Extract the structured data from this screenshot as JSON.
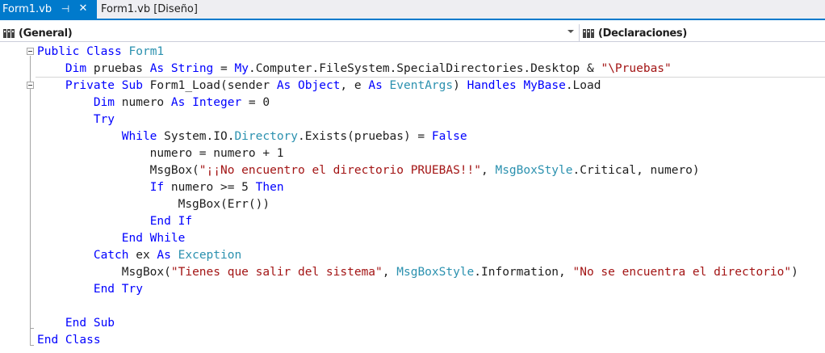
{
  "tabs": {
    "active": {
      "title": "Form1.vb",
      "pin_glyph": "⊣",
      "close_glyph": "✕"
    },
    "inactive": {
      "title": "Form1.vb [Diseño]"
    }
  },
  "navbar": {
    "left_label": "(General)",
    "right_label": "(Declaraciones)"
  },
  "colors": {
    "keyword": "#0000ff",
    "type": "#2b91af",
    "string": "#a31515",
    "plain": "#1e1e1e",
    "accent": "#007acc"
  },
  "code_lines": [
    [
      [
        "k",
        "Public Class "
      ],
      [
        "t",
        "Form1"
      ]
    ],
    [
      [
        "p",
        "    "
      ],
      [
        "k",
        "Dim"
      ],
      [
        "p",
        " pruebas "
      ],
      [
        "k",
        "As"
      ],
      [
        "p",
        " "
      ],
      [
        "k",
        "String"
      ],
      [
        "p",
        " = "
      ],
      [
        "k",
        "My"
      ],
      [
        "p",
        ".Computer.FileSystem.SpecialDirectories.Desktop & "
      ],
      [
        "s",
        "\"\\Pruebas\""
      ]
    ],
    [
      [
        "p",
        "    "
      ],
      [
        "k",
        "Private Sub"
      ],
      [
        "p",
        " Form1_Load(sender "
      ],
      [
        "k",
        "As"
      ],
      [
        "p",
        " "
      ],
      [
        "k",
        "Object"
      ],
      [
        "p",
        ", e "
      ],
      [
        "k",
        "As"
      ],
      [
        "p",
        " "
      ],
      [
        "t",
        "EventArgs"
      ],
      [
        "p",
        ") "
      ],
      [
        "k",
        "Handles"
      ],
      [
        "p",
        " "
      ],
      [
        "k",
        "MyBase"
      ],
      [
        "p",
        ".Load"
      ]
    ],
    [
      [
        "p",
        "        "
      ],
      [
        "k",
        "Dim"
      ],
      [
        "p",
        " numero "
      ],
      [
        "k",
        "As"
      ],
      [
        "p",
        " "
      ],
      [
        "k",
        "Integer"
      ],
      [
        "p",
        " = 0"
      ]
    ],
    [
      [
        "p",
        "        "
      ],
      [
        "k",
        "Try"
      ]
    ],
    [
      [
        "p",
        "            "
      ],
      [
        "k",
        "While"
      ],
      [
        "p",
        " System.IO."
      ],
      [
        "t",
        "Directory"
      ],
      [
        "p",
        ".Exists(pruebas) = "
      ],
      [
        "k",
        "False"
      ]
    ],
    [
      [
        "p",
        "                numero = numero + 1"
      ]
    ],
    [
      [
        "p",
        "                MsgBox("
      ],
      [
        "s",
        "\"¡¡No encuentro el directorio PRUEBAS!!\""
      ],
      [
        "p",
        ", "
      ],
      [
        "t",
        "MsgBoxStyle"
      ],
      [
        "p",
        ".Critical, numero)"
      ]
    ],
    [
      [
        "p",
        "                "
      ],
      [
        "k",
        "If"
      ],
      [
        "p",
        " numero >= 5 "
      ],
      [
        "k",
        "Then"
      ]
    ],
    [
      [
        "p",
        "                    MsgBox(Err())"
      ]
    ],
    [
      [
        "p",
        "                "
      ],
      [
        "k",
        "End If"
      ]
    ],
    [
      [
        "p",
        "            "
      ],
      [
        "k",
        "End While"
      ]
    ],
    [
      [
        "p",
        "        "
      ],
      [
        "k",
        "Catch"
      ],
      [
        "p",
        " ex "
      ],
      [
        "k",
        "As"
      ],
      [
        "p",
        " "
      ],
      [
        "t",
        "Exception"
      ]
    ],
    [
      [
        "p",
        "            MsgBox("
      ],
      [
        "s",
        "\"Tienes que salir del sistema\""
      ],
      [
        "p",
        ", "
      ],
      [
        "t",
        "MsgBoxStyle"
      ],
      [
        "p",
        ".Information, "
      ],
      [
        "s",
        "\"No se encuentra el directorio\""
      ],
      [
        "p",
        ")"
      ]
    ],
    [
      [
        "p",
        "        "
      ],
      [
        "k",
        "End Try"
      ]
    ],
    [
      [
        "p",
        ""
      ]
    ],
    [
      [
        "p",
        "    "
      ],
      [
        "k",
        "End Sub"
      ]
    ],
    [
      [
        "k",
        "End Class"
      ]
    ]
  ]
}
